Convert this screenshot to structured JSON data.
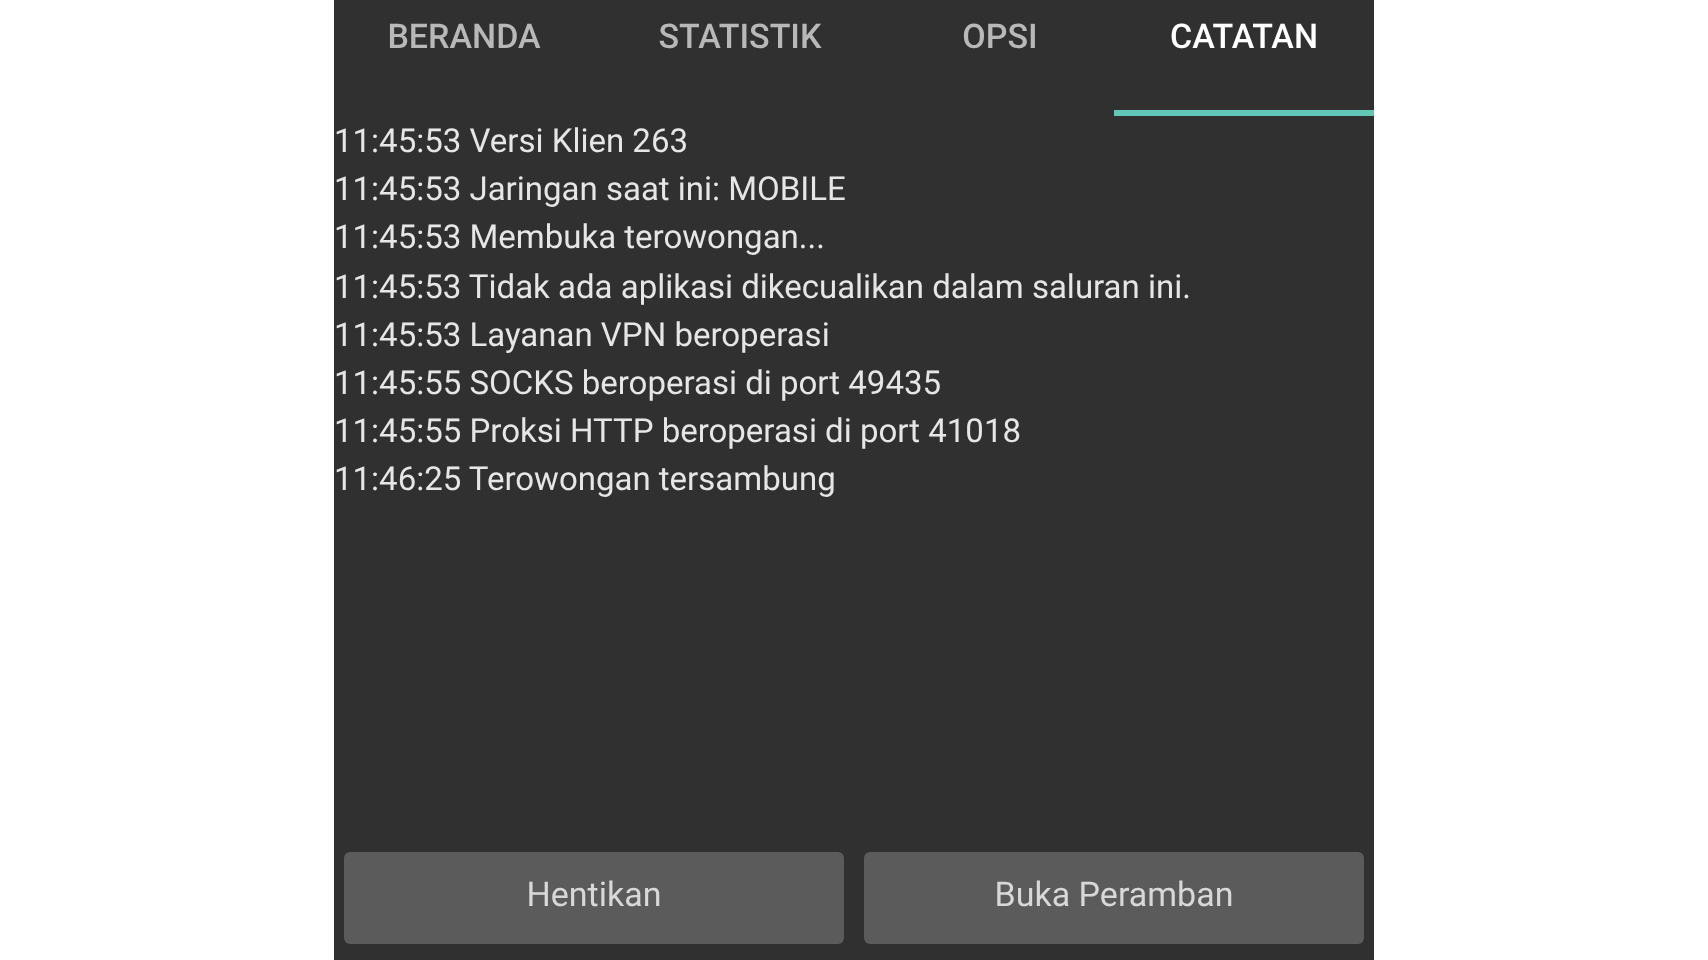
{
  "tabs": [
    {
      "label": "BERANDA",
      "selected": false
    },
    {
      "label": "STATISTIK",
      "selected": false
    },
    {
      "label": "OPSI",
      "selected": false
    },
    {
      "label": "CATATAN",
      "selected": true
    }
  ],
  "log": [
    {
      "time": "11:45:53",
      "message": "Versi Klien 263"
    },
    {
      "time": "11:45:53",
      "message": "Jaringan saat ini: MOBILE"
    },
    {
      "time": "11:45:53",
      "message": "Membuka terowongan..."
    },
    {
      "time": "11:45:53",
      "message": "Tidak ada aplikasi dikecualikan dalam saluran ini."
    },
    {
      "time": "11:45:53",
      "message": "Layanan VPN beroperasi"
    },
    {
      "time": "11:45:55",
      "message": "SOCKS beroperasi di port 49435"
    },
    {
      "time": "11:45:55",
      "message": "Proksi HTTP beroperasi di port 41018"
    },
    {
      "time": "11:46:25",
      "message": "Terowongan tersambung"
    }
  ],
  "buttons": [
    "Hentikan",
    "Buka Peramban"
  ]
}
